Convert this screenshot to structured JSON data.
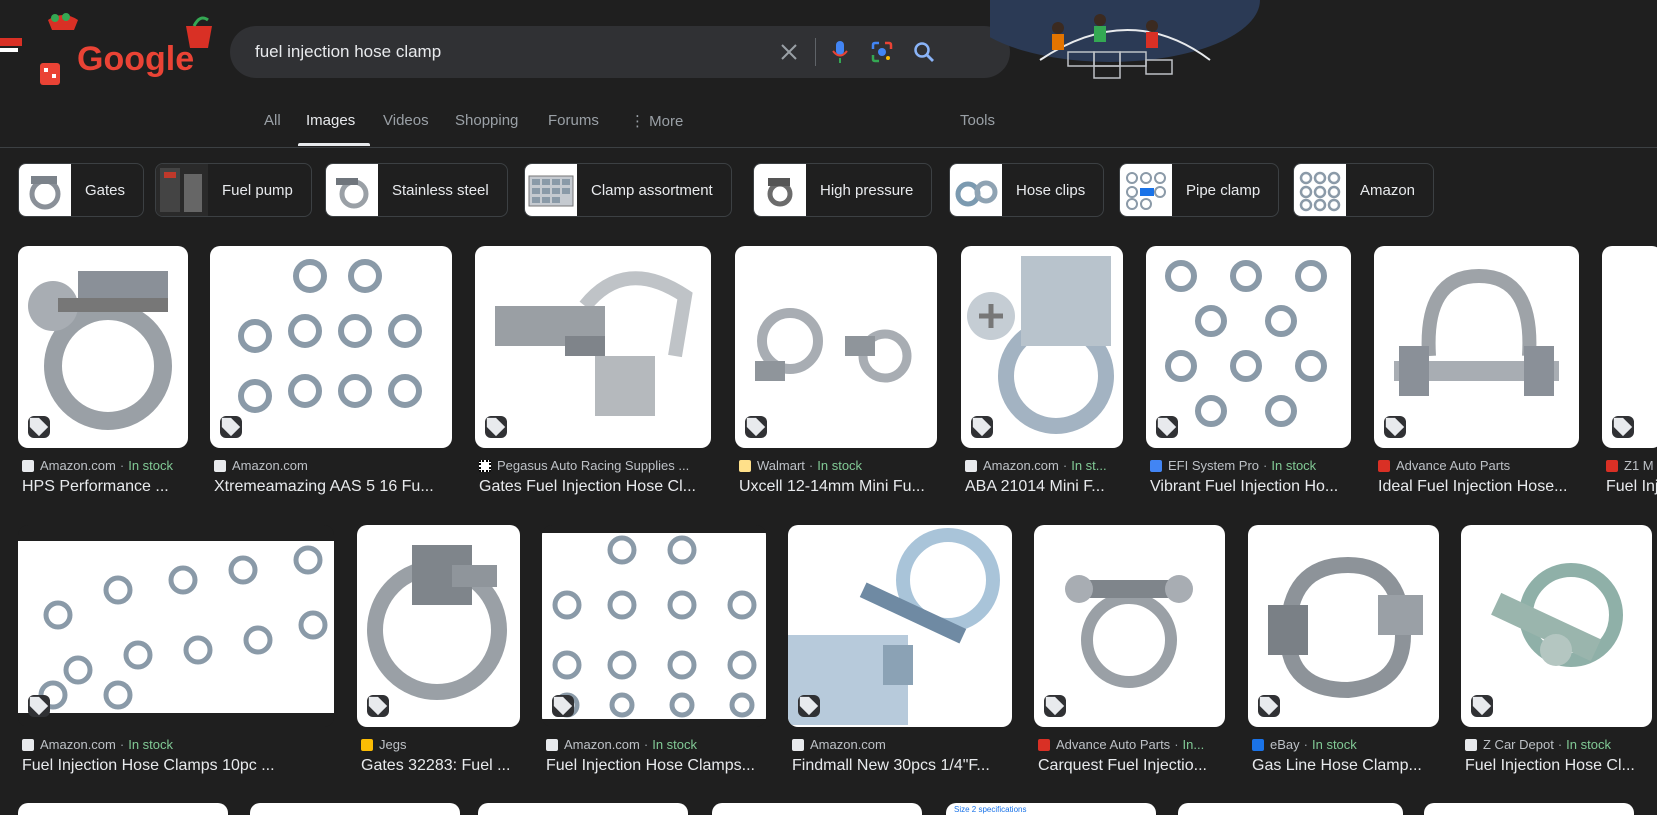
{
  "search": {
    "query": "fuel injection hose clamp"
  },
  "logo": {
    "text": "Google"
  },
  "tabs": [
    {
      "label": "All"
    },
    {
      "label": "Images"
    },
    {
      "label": "Videos"
    },
    {
      "label": "Shopping"
    },
    {
      "label": "Forums"
    },
    {
      "label": "More"
    }
  ],
  "tools_label": "Tools",
  "chips": [
    {
      "label": "Gates"
    },
    {
      "label": "Fuel pump"
    },
    {
      "label": "Stainless steel"
    },
    {
      "label": "Clamp assortment"
    },
    {
      "label": "High pressure"
    },
    {
      "label": "Hose clips"
    },
    {
      "label": "Pipe clamp"
    },
    {
      "label": "Amazon"
    }
  ],
  "row1": [
    {
      "source": "Amazon.com",
      "stock": "In stock",
      "title": "HPS Performance ..."
    },
    {
      "source": "Amazon.com",
      "stock": "",
      "title": "Xtremeamazing AAS 5 16 Fu..."
    },
    {
      "source": "Pegasus Auto Racing Supplies ...",
      "stock": "",
      "title": "Gates Fuel Injection Hose Cl..."
    },
    {
      "source": "Walmart",
      "stock": "In stock",
      "title": "Uxcell 12-14mm Mini Fu..."
    },
    {
      "source": "Amazon.com",
      "stock": "In st...",
      "title": "ABA 21014 Mini F..."
    },
    {
      "source": "EFI System Pro",
      "stock": "In stock",
      "title": "Vibrant Fuel Injection Ho..."
    },
    {
      "source": "Advance Auto Parts",
      "stock": "",
      "title": "Ideal Fuel Injection Hose..."
    },
    {
      "source": "Z1 M",
      "stock": "",
      "title": "Fuel Inj"
    }
  ],
  "row2": [
    {
      "source": "Amazon.com",
      "stock": "In stock",
      "title": "Fuel Injection Hose Clamps 10pc ..."
    },
    {
      "source": "Jegs",
      "stock": "",
      "title": "Gates 32283: Fuel ..."
    },
    {
      "source": "Amazon.com",
      "stock": "In stock",
      "title": "Fuel Injection Hose Clamps..."
    },
    {
      "source": "Amazon.com",
      "stock": "",
      "title": "Findmall New 30pcs 1/4\"F..."
    },
    {
      "source": "Advance Auto Parts",
      "stock": "In...",
      "title": "Carquest Fuel Injectio..."
    },
    {
      "source": "eBay",
      "stock": "In stock",
      "title": "Gas Line Hose Clamp..."
    },
    {
      "source": "Z Car Depot",
      "stock": "In stock",
      "title": "Fuel Injection Hose Cl..."
    }
  ],
  "peek_text": "Size 2 specifications",
  "colors": {
    "background": "#1f1f1f",
    "in_stock": "#81c995",
    "search_bg": "#303134"
  }
}
